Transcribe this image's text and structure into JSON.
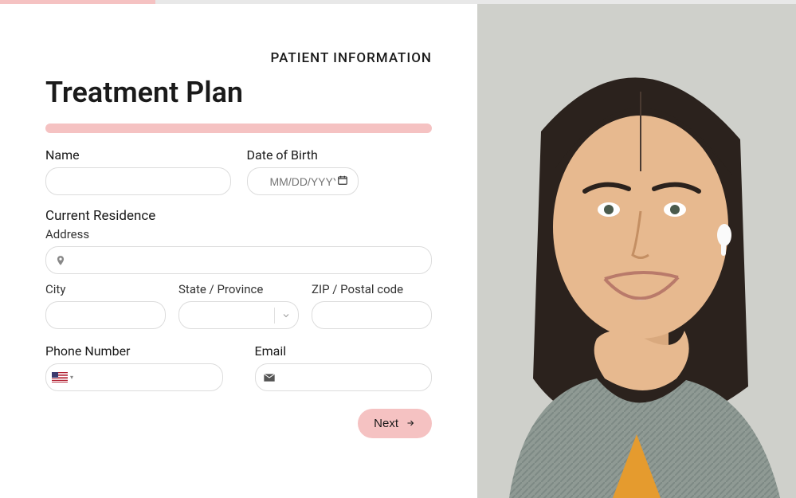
{
  "section_label": "PATIENT INFORMATION",
  "page_title": "Treatment Plan",
  "fields": {
    "name": {
      "label": "Name"
    },
    "dob": {
      "label": "Date of Birth",
      "placeholder": "MM/DD/YYYY"
    },
    "residence": {
      "label": "Current Residence"
    },
    "address": {
      "label": "Address"
    },
    "city": {
      "label": "City"
    },
    "state": {
      "label": "State / Province"
    },
    "zip": {
      "label": "ZIP / Postal code"
    },
    "phone": {
      "label": "Phone Number"
    },
    "email": {
      "label": "Email"
    }
  },
  "next_button": "Next",
  "colors": {
    "accent": "#f5c2c2",
    "text": "#1a1a1a",
    "border": "#dcdcdc"
  }
}
